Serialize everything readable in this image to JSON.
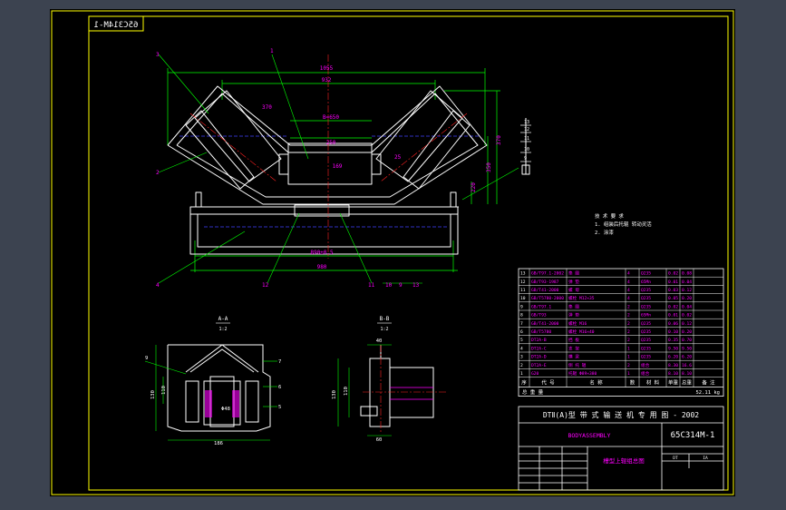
{
  "drawing": {
    "code": "65C314M-1",
    "title_mirrored": "65C314M-1",
    "standard_line": "DTⅡ(A)型   带 式 输 送 机 专 用 图 - 2002",
    "assembly_en": "BODYASSEMBLY",
    "assembly_cn": "槽型上辊组总图",
    "weight_label": "总 重 量",
    "weight_value": "52.11 kg",
    "code_small": "DT",
    "code_small2": "IA",
    "notes_line1": "技 术 要 求",
    "notes_line2": "1. 组装后托辊 转动灵活",
    "notes_line3": "2. 涂漆"
  },
  "view_labels": {
    "section_a": "A-A",
    "section_b": "B-B",
    "ratio_a": "1:2",
    "ratio_b": "1:2"
  },
  "dims": {
    "d1055": "1055",
    "d932": "932",
    "d450": "B=650",
    "d250": "250",
    "d370": "370",
    "d350": "350",
    "d169": "169",
    "d890": "890±0.5",
    "d980": "980",
    "d220": "220",
    "d25": "25",
    "d200": "200",
    "d186": "186",
    "d130": "130",
    "d60": "60",
    "d48": "Φ48",
    "d110": "110",
    "d40": "40"
  },
  "parts_header": {
    "col1": "序",
    "col2": "代 号",
    "col3": "名 称",
    "col4": "数",
    "col5": "材 料",
    "col6": "单重",
    "col7": "总重",
    "col8": "备 注"
  },
  "parts": [
    {
      "no": "13",
      "code": "GB/T97.1-2002",
      "name": "垫 圈",
      "qty": "4",
      "mat": "Q235",
      "w1": "0.02",
      "w2": "0.08"
    },
    {
      "no": "12",
      "code": "GB/T93-1987",
      "name": "弹 垫",
      "qty": "4",
      "mat": "65Mn",
      "w1": "0.01",
      "w2": "0.04"
    },
    {
      "no": "11",
      "code": "GB/T41-2000",
      "name": "螺 母",
      "qty": "4",
      "mat": "Q235",
      "w1": "0.03",
      "w2": "0.12"
    },
    {
      "no": "10",
      "code": "GB/T5780-2000",
      "name": "螺栓 M12×35",
      "qty": "4",
      "mat": "Q235",
      "w1": "0.05",
      "w2": "0.20"
    },
    {
      "no": "9",
      "code": "GB/T97.1",
      "name": "垫 圈",
      "qty": "2",
      "mat": "Q235",
      "w1": "0.02",
      "w2": "0.04"
    },
    {
      "no": "8",
      "code": "GB/T93",
      "name": "弹 垫",
      "qty": "2",
      "mat": "65Mn",
      "w1": "0.01",
      "w2": "0.02"
    },
    {
      "no": "7",
      "code": "GB/T41-2000",
      "name": "螺栓 M16",
      "qty": "2",
      "mat": "Q235",
      "w1": "0.06",
      "w2": "0.12"
    },
    {
      "no": "6",
      "code": "GB/T5780",
      "name": "螺栓 M16×40",
      "qty": "2",
      "mat": "Q235",
      "w1": "0.10",
      "w2": "0.20"
    },
    {
      "no": "5",
      "code": "DT2A-B",
      "name": "挡 板",
      "qty": "2",
      "mat": "Q235",
      "w1": "0.35",
      "w2": "0.70"
    },
    {
      "no": "4",
      "code": "DT2A-C",
      "name": "支 架",
      "qty": "1",
      "mat": "Q235",
      "w1": "9.50",
      "w2": "9.50"
    },
    {
      "no": "3",
      "code": "DT2A-D",
      "name": "横 梁",
      "qty": "1",
      "mat": "Q235",
      "w1": "6.20",
      "w2": "6.20"
    },
    {
      "no": "2",
      "code": "DT2A-E",
      "name": "侧 托 辊",
      "qty": "2",
      "mat": "组合",
      "w1": "8.30",
      "w2": "16.6"
    },
    {
      "no": "1",
      "code": "G20",
      "name": "托辊 Φ89×380",
      "qty": "1",
      "mat": "组合",
      "w1": "8.10",
      "w2": "8.10"
    }
  ],
  "balloons": {
    "b1": "1",
    "b2": "2",
    "b3": "3",
    "b4": "4",
    "b5": "5",
    "b6": "6",
    "b7": "7",
    "b8": "8",
    "b9": "9",
    "b10": "10",
    "b11": "11",
    "b12": "12",
    "b13": "13"
  },
  "colors": {
    "background": "#3c4350",
    "paper": "#000000",
    "frame": "#ffff00",
    "outline": "#ffffff",
    "dimension": "#00ff00",
    "text": "#ff00ff",
    "center": "#ff2020",
    "hidden": "#4040ff",
    "border_text": "#ffff00"
  }
}
